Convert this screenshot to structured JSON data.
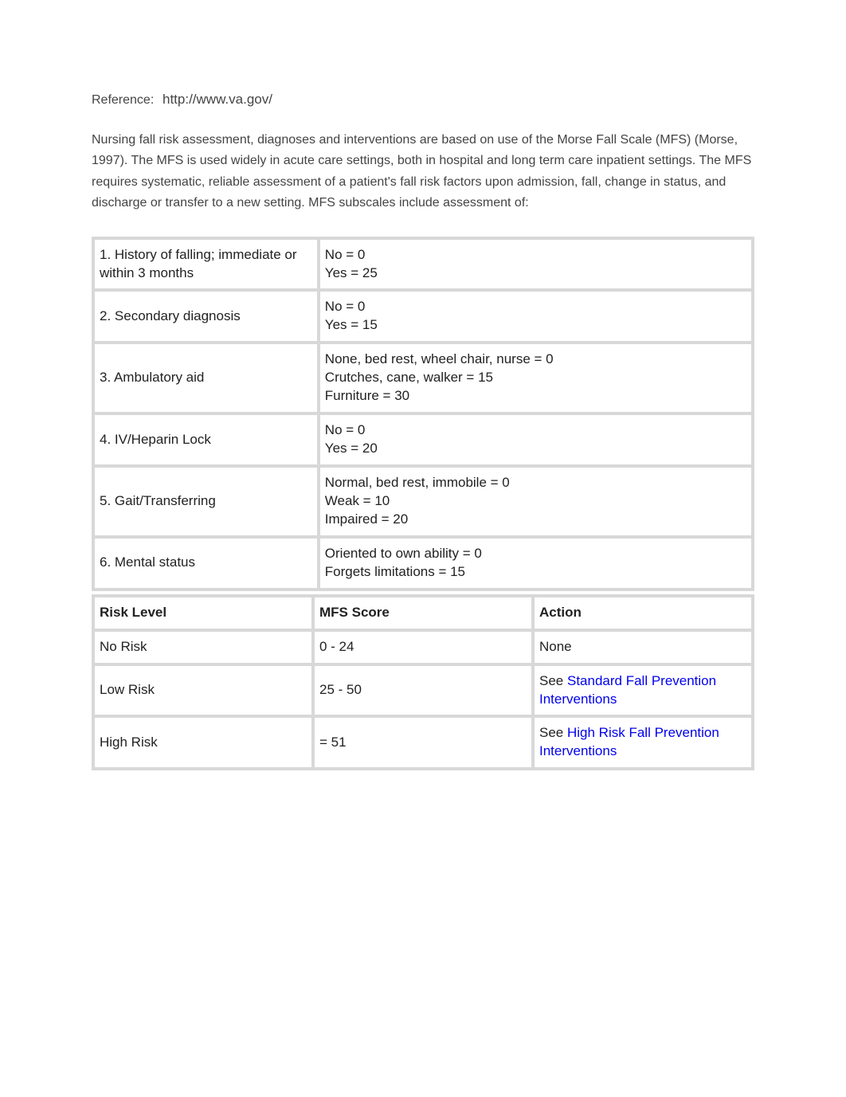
{
  "reference": {
    "label": "Reference:",
    "url": "http://www.va.gov/"
  },
  "intro_paragraph": "Nursing fall risk assessment, diagnoses and interventions are based on use of the Morse Fall Scale (MFS) (Morse, 1997). The MFS is used widely in acute care settings, both in hospital and long term care inpatient settings. The MFS requires systematic, reliable assessment of a patient's fall risk factors upon admission, fall, change in status, and discharge or transfer to a new setting. MFS subscales include assessment of:",
  "assessment_rows": [
    {
      "label": "1. History of falling; immediate or within 3 months",
      "scoring": "No = 0\nYes = 25"
    },
    {
      "label": "2. Secondary diagnosis",
      "scoring": "No = 0\nYes = 15"
    },
    {
      "label": "3. Ambulatory aid",
      "scoring": "None, bed rest, wheel chair, nurse = 0\nCrutches, cane, walker = 15\nFurniture = 30"
    },
    {
      "label": "4. IV/Heparin Lock",
      "scoring": "No = 0\nYes = 20"
    },
    {
      "label": "5. Gait/Transferring",
      "scoring": "Normal, bed rest, immobile = 0\nWeak = 10\nImpaired = 20"
    },
    {
      "label": "6. Mental status",
      "scoring": "Oriented to own ability = 0\nForgets limitations = 15"
    }
  ],
  "risk_table": {
    "headers": {
      "risk_level": "Risk Level",
      "mfs_score": "MFS Score",
      "action": "Action"
    },
    "rows": [
      {
        "level": "No Risk",
        "score": "0 - 24",
        "action_prefix": "",
        "action_link": "",
        "action_plain": "None"
      },
      {
        "level": "Low Risk",
        "score": "25 - 50",
        "action_prefix": "See ",
        "action_link": "Standard Fall Prevention Interventions",
        "action_plain": ""
      },
      {
        "level": "High Risk",
        "score": "= 51",
        "action_prefix": "See ",
        "action_link": "High Risk Fall Prevention Interventions",
        "action_plain": ""
      }
    ]
  }
}
